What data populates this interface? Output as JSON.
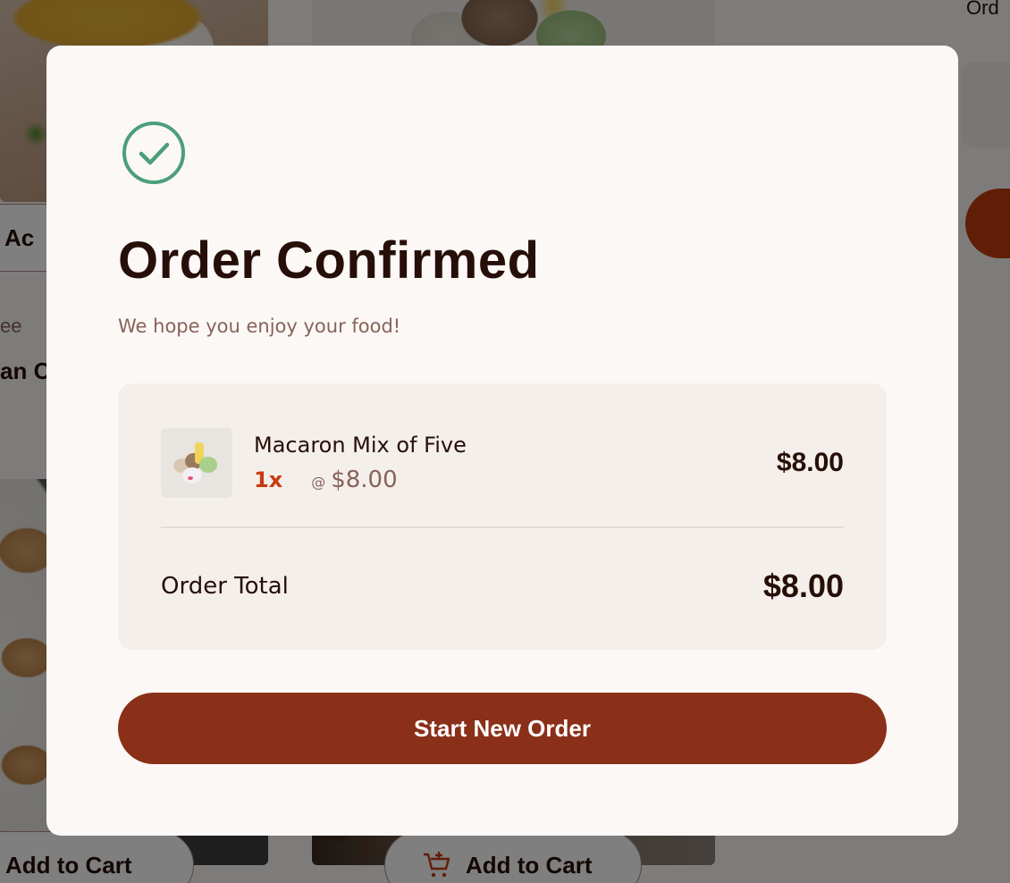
{
  "background": {
    "orders_heading": "Ord",
    "card_category": "ee",
    "card_name": "an C",
    "add_to_cart_partial": "Ac",
    "add_to_cart_label": "Add to Cart"
  },
  "modal": {
    "icon": "check-circle-icon",
    "title": "Order Confirmed",
    "subtitle": "We hope you enjoy your food!",
    "items": [
      {
        "name": "Macaron Mix of Five",
        "quantity": "1x",
        "at_symbol": "@",
        "unit_price": "$8.00",
        "line_total": "$8.00"
      }
    ],
    "total_label": "Order Total",
    "total_value": "$8.00",
    "cta_label": "Start New Order"
  },
  "colors": {
    "brand_red": "#c73b0f",
    "cta_background": "#8a2f18",
    "text_dark": "#260f08",
    "text_muted": "#87635a",
    "success_green": "#4d9e7a"
  }
}
